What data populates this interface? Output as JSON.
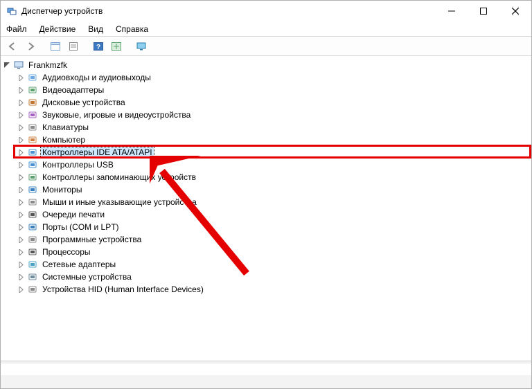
{
  "window": {
    "title": "Диспетчер устройств"
  },
  "menu": {
    "file": "Файл",
    "action": "Действие",
    "view": "Вид",
    "help": "Справка"
  },
  "toolbar": {
    "back": "back",
    "forward": "forward",
    "properties": "properties",
    "list": "list",
    "help": "help",
    "update": "update",
    "monitor": "monitor"
  },
  "tree": {
    "root": "Frankmzfk",
    "items": [
      {
        "label": "Аудиовходы и аудиовыходы"
      },
      {
        "label": "Видеоадаптеры"
      },
      {
        "label": "Дисковые устройства"
      },
      {
        "label": "Звуковые, игровые и видеоустройства"
      },
      {
        "label": "Клавиатуры"
      },
      {
        "label": "Компьютер"
      },
      {
        "label": "Контроллеры IDE ATA/ATAPI",
        "selected": true,
        "highlight": true
      },
      {
        "label": "Контроллеры USB"
      },
      {
        "label": "Контроллеры запоминающих устройств"
      },
      {
        "label": "Мониторы"
      },
      {
        "label": "Мыши и иные указывающие устройства"
      },
      {
        "label": "Очереди печати"
      },
      {
        "label": "Порты (COM и LPT)"
      },
      {
        "label": "Программные устройства"
      },
      {
        "label": "Процессоры"
      },
      {
        "label": "Сетевые адаптеры"
      },
      {
        "label": "Системные устройства"
      },
      {
        "label": "Устройства HID (Human Interface Devices)"
      }
    ]
  }
}
